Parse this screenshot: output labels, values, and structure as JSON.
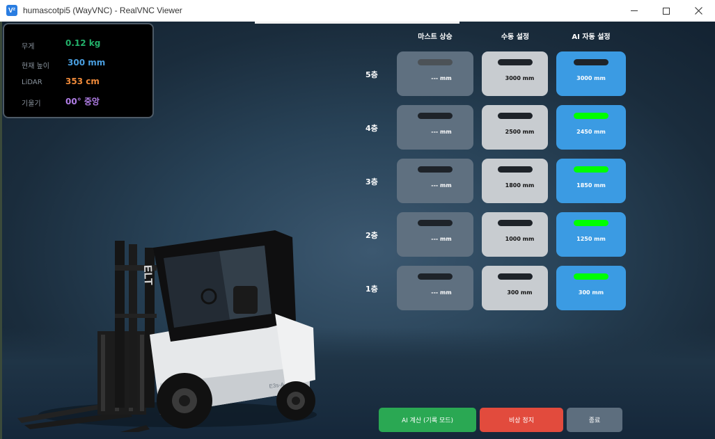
{
  "window": {
    "title": "humascotpi5 (WayVNC) - RealVNC Viewer",
    "app_icon": "realvnc-icon",
    "controls": [
      "minimize-icon",
      "maximize-icon",
      "close-icon"
    ]
  },
  "sensors": {
    "weight": {
      "label": "무게",
      "value": "0.12 kg",
      "color": "#23b06a"
    },
    "height": {
      "label": "현재 높이",
      "value": "300 mm",
      "color": "#4a9fe0"
    },
    "lidar": {
      "label": "LiDAR",
      "value": "353 cm",
      "color": "#ef8a3a"
    },
    "tilt": {
      "label": "기울기",
      "value": "00°  중앙",
      "color": "#b17ee6"
    }
  },
  "table": {
    "headers": {
      "mast": "마스트 상승",
      "manual": "수동 설정",
      "ai": "AI 자동 설정"
    },
    "rows": [
      {
        "floor": "5층",
        "mast": "--- mm",
        "manual": "3000 mm",
        "ai": "3000 mm",
        "mast_indicator": "dim",
        "ai_indicator": "dark"
      },
      {
        "floor": "4층",
        "mast": "--- mm",
        "manual": "2500 mm",
        "ai": "2450 mm",
        "mast_indicator": "dark",
        "ai_indicator": "green"
      },
      {
        "floor": "3층",
        "mast": "--- mm",
        "manual": "1800 mm",
        "ai": "1850 mm",
        "mast_indicator": "dark",
        "ai_indicator": "green"
      },
      {
        "floor": "2층",
        "mast": "--- mm",
        "manual": "1000 mm",
        "ai": "1250 mm",
        "mast_indicator": "dark",
        "ai_indicator": "green"
      },
      {
        "floor": "1층",
        "mast": "--- mm",
        "manual": "300 mm",
        "ai": "300 mm",
        "mast_indicator": "dark",
        "ai_indicator": "green"
      }
    ]
  },
  "buttons": {
    "ai_calc": "AI 계산 (기록 모드)",
    "emergency_stop": "비상 정지",
    "exit": "종료"
  },
  "colors": {
    "indicator_green": "#00ff00",
    "ai_cell": "#3b9be3",
    "manual_cell": "#c8ccd0",
    "mast_cell": "#5f7080",
    "btn_ai": "#2aa853",
    "btn_stop": "#e24b3d",
    "btn_exit": "#5d6e7e"
  },
  "forklift": {
    "brand": "ELT",
    "model": "E3s-A"
  }
}
